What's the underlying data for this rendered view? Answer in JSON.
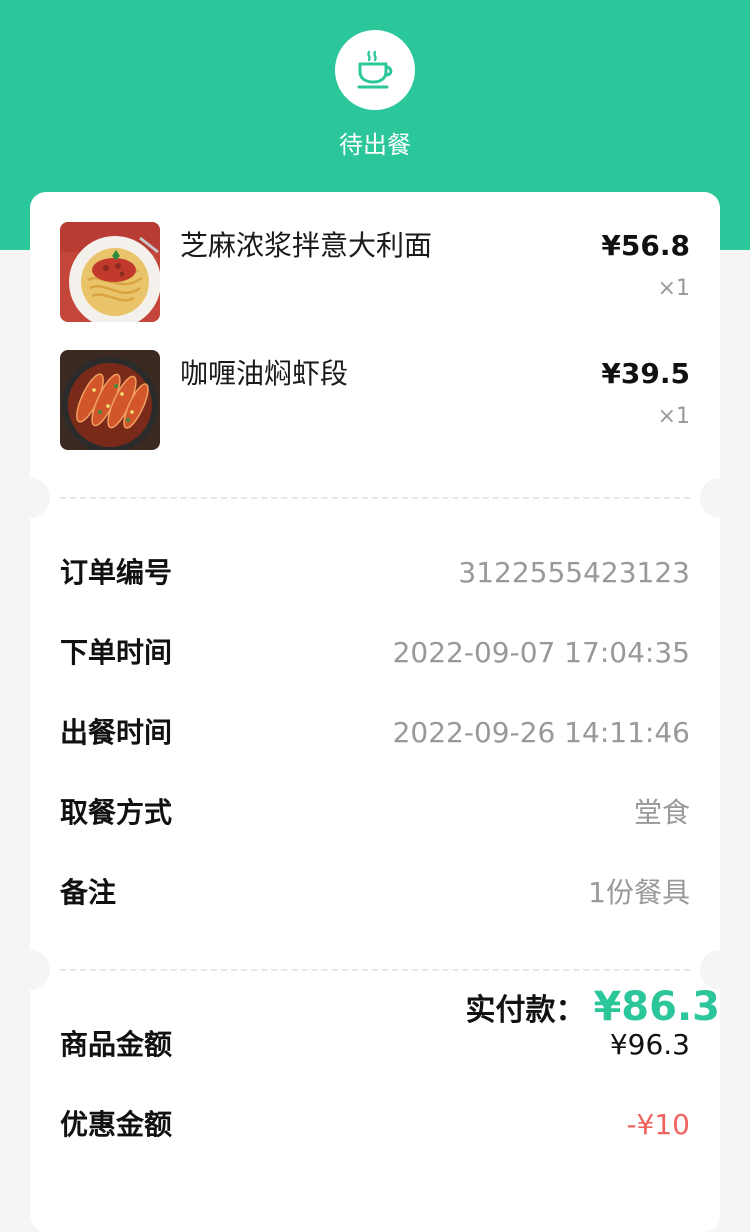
{
  "header": {
    "status_icon": "coffee-cup-icon",
    "status_text": "待出餐",
    "accent_color": "#2cc69b"
  },
  "items": [
    {
      "name": "芝麻浓浆拌意大利面",
      "price": "¥56.8",
      "qty": "×1",
      "image": "pasta-bolognese"
    },
    {
      "name": "咖喱油焖虾段",
      "price": "¥39.5",
      "qty": "×1",
      "image": "braised-shrimp"
    }
  ],
  "info": {
    "order_no_label": "订单编号",
    "order_no": "3122555423123",
    "order_time_label": "下单时间",
    "order_time": "2022-09-07 17:04:35",
    "serve_time_label": "出餐时间",
    "serve_time": "2022-09-26 14:11:46",
    "pickup_label": "取餐方式",
    "pickup": "堂食",
    "remark_label": "备注",
    "remark": "1份餐具"
  },
  "summary": {
    "goods_label": "商品金额",
    "goods_amount": "¥96.3",
    "discount_label": "优惠金额",
    "discount_amount": "-¥10",
    "paid_label": "实付款：",
    "paid_amount": "¥86.3",
    "discount_color": "#f0645f"
  }
}
